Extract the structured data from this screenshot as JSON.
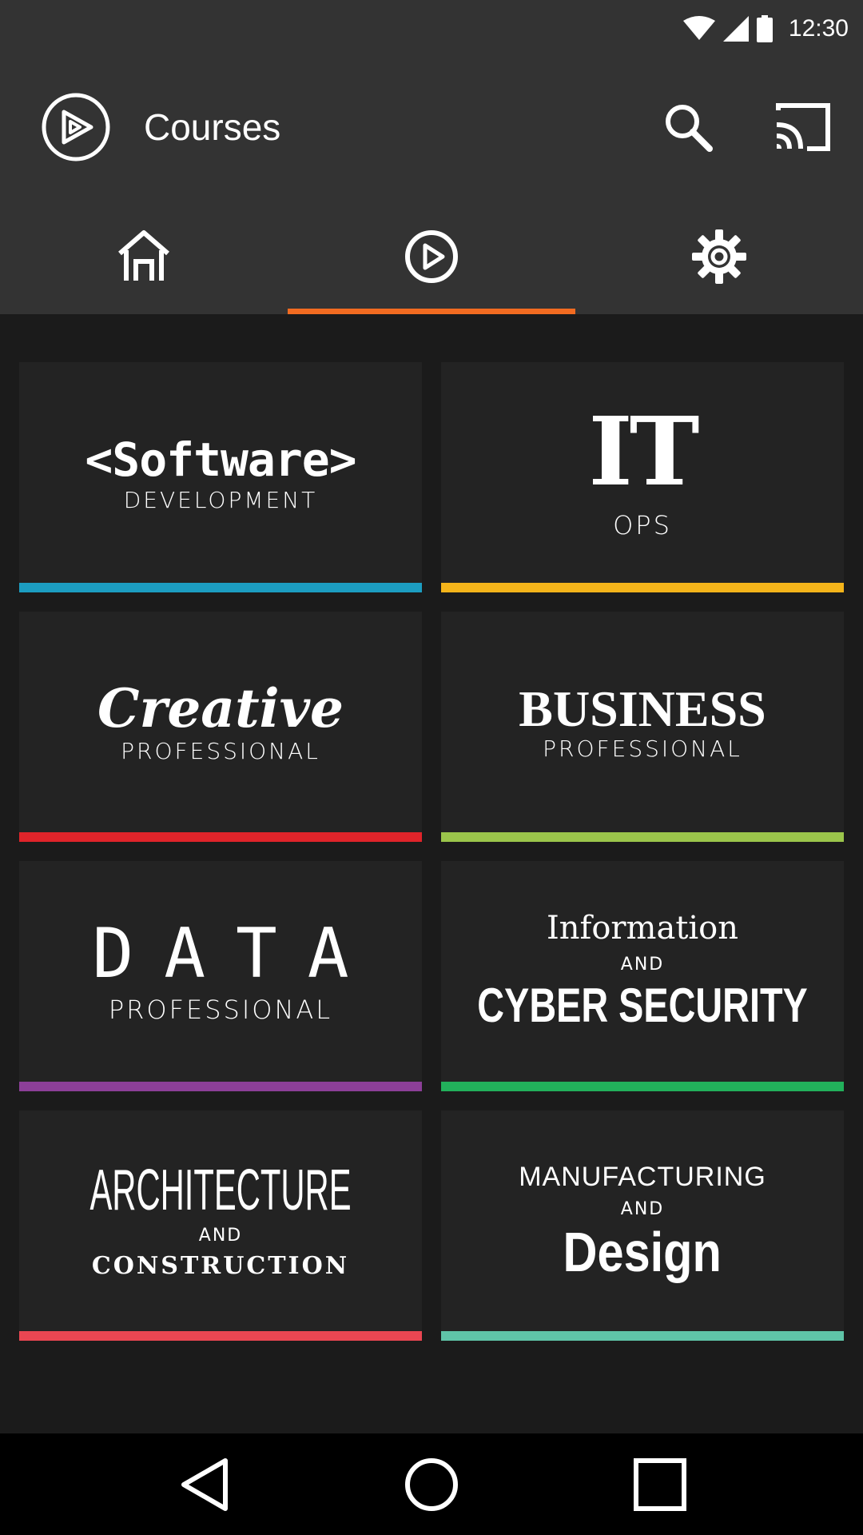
{
  "status_bar": {
    "time": "12:30",
    "icons": [
      "wifi-icon",
      "cellular-signal-icon",
      "battery-icon"
    ]
  },
  "app_bar": {
    "title": "Courses",
    "logo_icon": "pluralsight-logo-icon",
    "actions": [
      "search-icon",
      "cast-icon"
    ]
  },
  "tabs": [
    {
      "icon": "home-icon",
      "selected": false
    },
    {
      "icon": "play-circle-icon",
      "selected": true
    },
    {
      "icon": "gear-icon",
      "selected": false
    }
  ],
  "colors": {
    "background": "#1b1b1b",
    "bar": "#333333",
    "card": "#232323",
    "tab_indicator": "#f26b21"
  },
  "categories": [
    {
      "main": "<Software>",
      "sub": "DEVELOPMENT",
      "accent": "#1c9dc1"
    },
    {
      "main": "IT",
      "sub": "OPS",
      "accent": "#f4b41a"
    },
    {
      "main": "Creative",
      "sub": "PROFESSIONAL",
      "accent": "#e0242a"
    },
    {
      "main": "BUSINESS",
      "sub": "PROFESSIONAL",
      "accent": "#9bc54b"
    },
    {
      "main": "DATA",
      "sub": "PROFESSIONAL",
      "accent": "#8c3f98"
    },
    {
      "top": "Information",
      "and": "AND",
      "bottom": "CYBER SECURITY",
      "accent": "#22b05b"
    },
    {
      "top": "ARCHITECTURE",
      "and": "AND",
      "bottom": "CONSTRUCTION",
      "accent": "#ea4652"
    },
    {
      "top": "MANUFACTURING",
      "and": "AND",
      "bottom": "Design",
      "accent": "#5fc4a8"
    }
  ],
  "nav_bar": [
    "back-icon",
    "home-circle-icon",
    "recents-icon"
  ]
}
